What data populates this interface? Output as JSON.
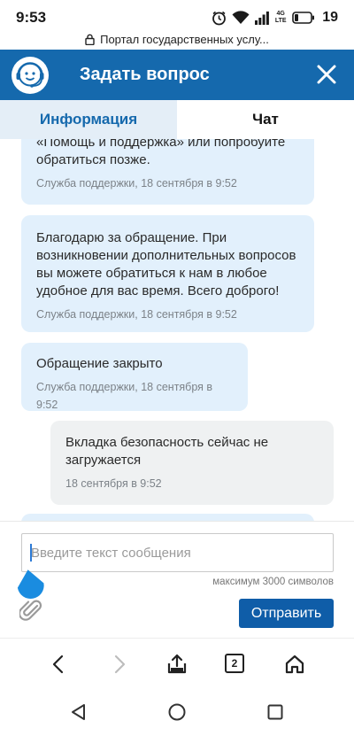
{
  "status_bar": {
    "time": "9:53",
    "network": "4G LTE",
    "battery": "19"
  },
  "browser": {
    "url_text": "Портал государственных услу...",
    "tab_count": "2"
  },
  "header": {
    "title": "Задать вопрос",
    "color": "#1569ad"
  },
  "tabs": [
    {
      "label": "Информация",
      "active": true
    },
    {
      "label": "Чат",
      "active": false
    }
  ],
  "messages": [
    {
      "type": "support",
      "text": "«Помощь и поддержка» или попробуйте обратиться позже.",
      "meta": "Служба поддержки, 18 сентября в 9:52"
    },
    {
      "type": "support",
      "text": "Благодарю за обращение. При возникновении дополнительных вопросов вы можете обратиться к нам в любое удобное для вас время. Всего доброго!",
      "meta": "Служба поддержки, 18 сентября в 9:52"
    },
    {
      "type": "support",
      "text": "Обращение закрыто",
      "meta": "Служба поддержки, 18 сентября в 9:52"
    },
    {
      "type": "user",
      "text": "Вкладка безопасность сейчас не загружается",
      "meta": "18 сентября в 9:52"
    }
  ],
  "composer": {
    "placeholder": "Введите текст сообщения",
    "value": "",
    "limit_text": "максимум 3000 символов",
    "send_label": "Отправить"
  },
  "icons": {
    "avatar": "support-operator-icon",
    "close": "close-icon",
    "attach": "paperclip-icon",
    "lock": "lock-icon",
    "back": "chevron-left-icon",
    "forward": "chevron-right-icon",
    "share": "share-icon",
    "home": "home-icon"
  }
}
